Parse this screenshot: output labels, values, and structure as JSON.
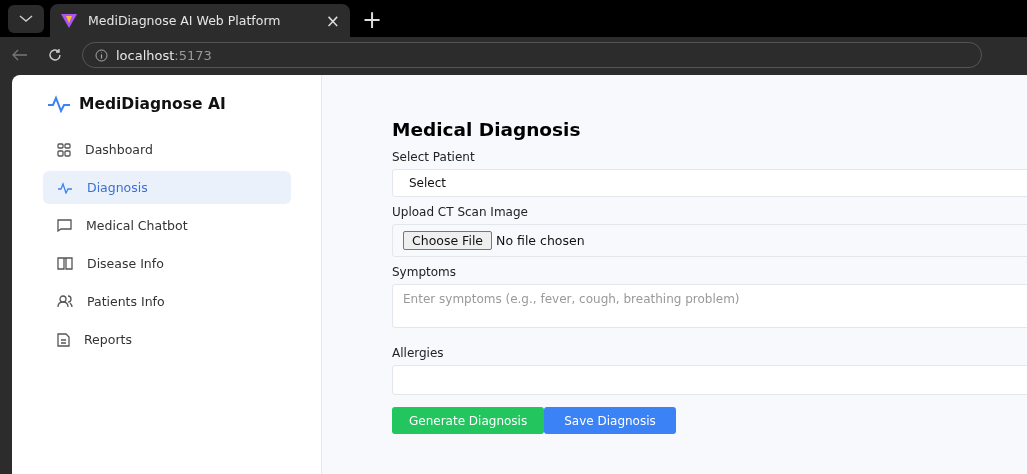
{
  "browser": {
    "tab_title": "MediDiagnose AI Web Platform",
    "close": "×",
    "new_tab": "+",
    "address_host": "localhost",
    "address_port": ":5173"
  },
  "sidebar": {
    "brand": "MediDiagnose AI",
    "items": [
      {
        "label": "Dashboard",
        "selected": false
      },
      {
        "label": "Diagnosis",
        "selected": true
      },
      {
        "label": "Medical Chatbot",
        "selected": false
      },
      {
        "label": "Disease Info",
        "selected": false
      },
      {
        "label": "Patients Info",
        "selected": false
      },
      {
        "label": "Reports",
        "selected": false
      }
    ]
  },
  "form": {
    "title": "Medical Diagnosis",
    "patient": {
      "label": "Select Patient",
      "value": "Select"
    },
    "upload": {
      "label": "Upload CT Scan Image",
      "button": "Choose File",
      "status": "No file chosen"
    },
    "symptoms": {
      "label": "Symptoms",
      "placeholder": "Enter symptoms (e.g., fever, cough, breathing problem)"
    },
    "allergies": {
      "label": "Allergies"
    },
    "buttons": [
      {
        "label": "Generate Diagnosis",
        "kind": "primary"
      },
      {
        "label": "Save Diagnosis",
        "kind": "secondary"
      }
    ]
  }
}
